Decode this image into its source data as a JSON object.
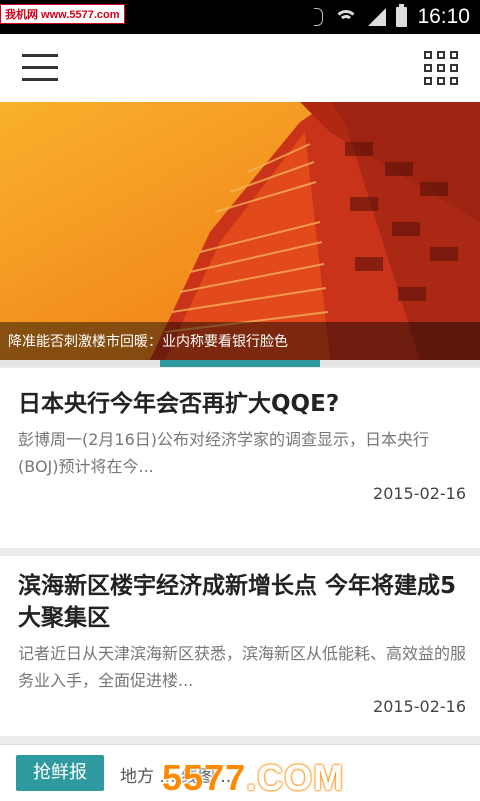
{
  "status_bar": {
    "watermark_text": "我机网 www.5577.com",
    "time": "16:10",
    "icons": [
      "bluetooth-icon",
      "wifi-icon",
      "signal-icon",
      "battery-icon"
    ]
  },
  "toolbar": {
    "menu_icon": "hamburger-menu-icon",
    "grid_icon": "grid-apps-icon"
  },
  "hero": {
    "caption": "降准能否刺激楼市回暖：业内称要看银行脸色",
    "carousel_total": 3,
    "carousel_active": 2
  },
  "articles": [
    {
      "title": "日本央行今年会否再扩大QQE?",
      "summary": "彭博周一(2月16日)公布对经济学家的调查显示，日本央行(BOJ)预计将在今...",
      "date": "2015-02-16"
    },
    {
      "title": "滨海新区楼宇经济成新增长点 今年将建成5大聚集区",
      "summary": "记者近日从天津滨海新区获悉，滨海新区从低能耗、高效益的服务业入手，全面促进楼...",
      "date": "2015-02-16"
    }
  ],
  "bottom_bar": {
    "button_label": "抢鲜报",
    "ticker_text": "地方 ... 线图 ..."
  },
  "watermark": {
    "main": "5577",
    "suffix": ".COM"
  },
  "colors": {
    "accent": "#2e9aa0",
    "hero_orange": "#f2861b",
    "watermark_orange": "#ff8a00"
  }
}
